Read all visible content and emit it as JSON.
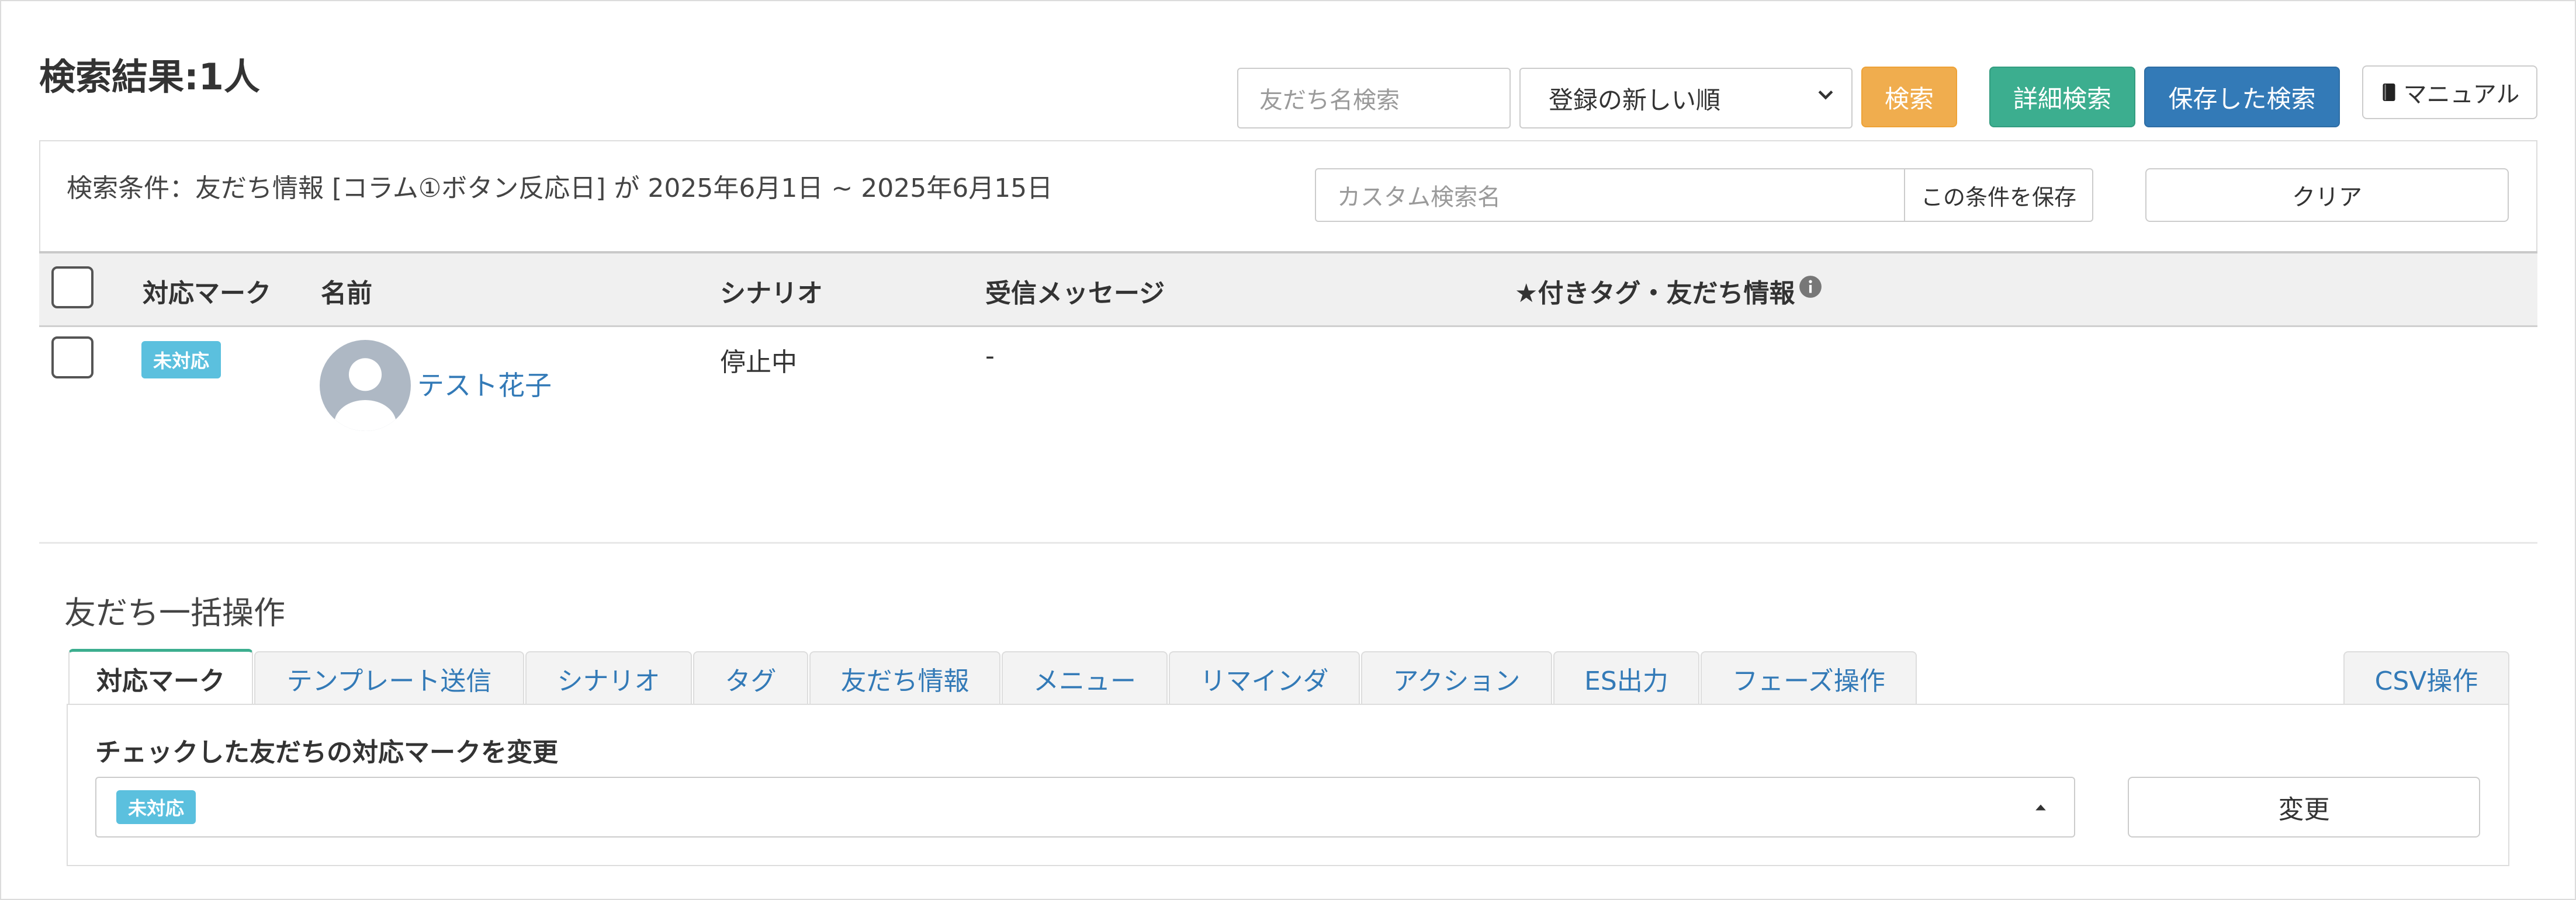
{
  "page_title": "検索結果:1人",
  "search": {
    "name_placeholder": "友だち名検索",
    "sort_selected": "登録の新しい順",
    "search_label": "検索",
    "advanced_label": "詳細検索",
    "saved_label": "保存した検索",
    "manual_label": "マニュアル"
  },
  "conditions": {
    "text": "検索条件：友だち情報 [コラム①ボタン反応日] が 2025年6月1日 ~ 2025年6月15日",
    "custom_name_placeholder": "カスタム検索名",
    "save_label": "この条件を保存",
    "clear_label": "クリア"
  },
  "table": {
    "headers": {
      "mark": "対応マーク",
      "name": "名前",
      "scenario": "シナリオ",
      "message": "受信メッセージ",
      "tags": "★付きタグ・友だち情報"
    },
    "rows": [
      {
        "mark": "未対応",
        "name": "テスト花子",
        "scenario": "停止中",
        "message": "-"
      }
    ]
  },
  "bulk": {
    "title": "友だち一括操作",
    "tabs": [
      "対応マーク",
      "テンプレート送信",
      "シナリオ",
      "タグ",
      "友だち情報",
      "メニュー",
      "リマインダ",
      "アクション",
      "ES出力",
      "フェーズ操作"
    ],
    "csv_tab": "CSV操作",
    "active_tab": "対応マーク",
    "panel_label": "チェックした友だちの対応マークを変更",
    "selected_mark": "未対応",
    "change_label": "変更"
  },
  "colors": {
    "accent_green": "#3cae8f",
    "accent_blue": "#337ab7",
    "accent_orange": "#f0ad4e",
    "badge_cyan": "#5bc0de"
  }
}
